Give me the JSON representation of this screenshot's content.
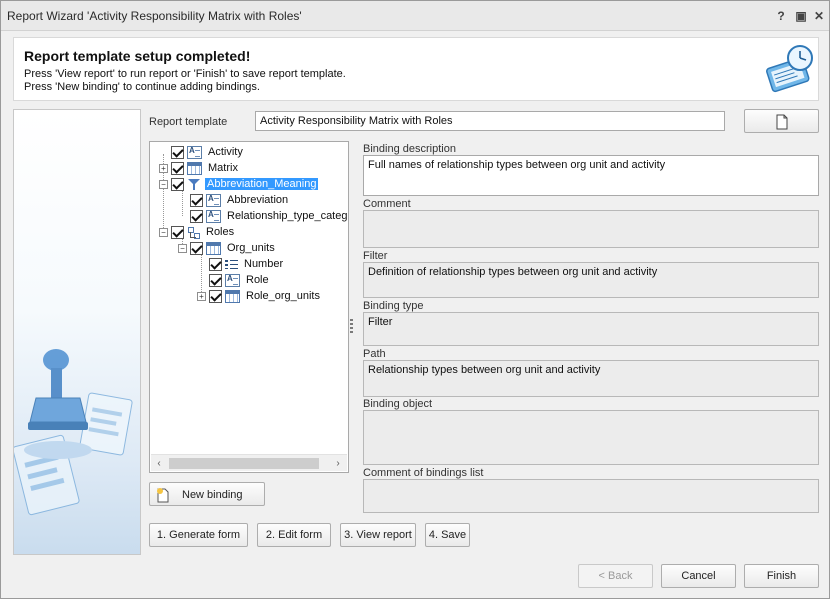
{
  "window": {
    "title": "Report Wizard 'Activity Responsibility Matrix with Roles'",
    "help_label": "?",
    "restore_label": "▣",
    "close_label": "✕"
  },
  "header": {
    "title": "Report template setup completed!",
    "line1": "Press 'View report' to run report or 'Finish' to save report template.",
    "line2": "Press 'New binding' to continue adding bindings."
  },
  "template": {
    "label": "Report template",
    "value": "Activity Responsibility Matrix with Roles"
  },
  "tree": {
    "items": [
      {
        "label": "Activity",
        "icon": "text-field-icon",
        "expander": ""
      },
      {
        "label": "Matrix",
        "icon": "table-icon",
        "expander": "+"
      },
      {
        "label": "Abbreviation_Meaning",
        "icon": "filter-icon",
        "expander": "−"
      },
      {
        "label": "Abbreviation",
        "icon": "text-field-icon",
        "expander": ""
      },
      {
        "label": "Relationship_type_category",
        "icon": "text-field-icon",
        "expander": ""
      },
      {
        "label": "Roles",
        "icon": "hierarchy-icon",
        "expander": "−"
      },
      {
        "label": "Org_units",
        "icon": "table-icon",
        "expander": "−"
      },
      {
        "label": "Number",
        "icon": "list-icon",
        "expander": ""
      },
      {
        "label": "Role",
        "icon": "text-field-icon",
        "expander": ""
      },
      {
        "label": "Role_org_units",
        "icon": "table-icon",
        "expander": "+"
      }
    ],
    "selected": "Abbreviation_Meaning"
  },
  "fields": {
    "binding_description": {
      "label": "Binding description",
      "value": "Full names of relationship types between org unit and activity"
    },
    "comment": {
      "label": "Comment",
      "value": ""
    },
    "filter": {
      "label": "Filter",
      "value": "Definition of relationship types between org unit and activity"
    },
    "binding_type": {
      "label": "Binding type",
      "value": "Filter"
    },
    "path": {
      "label": "Path",
      "value": "Relationship types between org unit and activity"
    },
    "binding_object": {
      "label": "Binding object",
      "value": ""
    },
    "comment_list": {
      "label": "Comment of bindings list",
      "value": ""
    }
  },
  "buttons": {
    "new_binding": "New binding",
    "generate_form": "1. Generate form",
    "edit_form": "2. Edit form",
    "view_report": "3. View report",
    "save": "4. Save",
    "back": "< Back",
    "cancel": "Cancel",
    "finish": "Finish"
  }
}
